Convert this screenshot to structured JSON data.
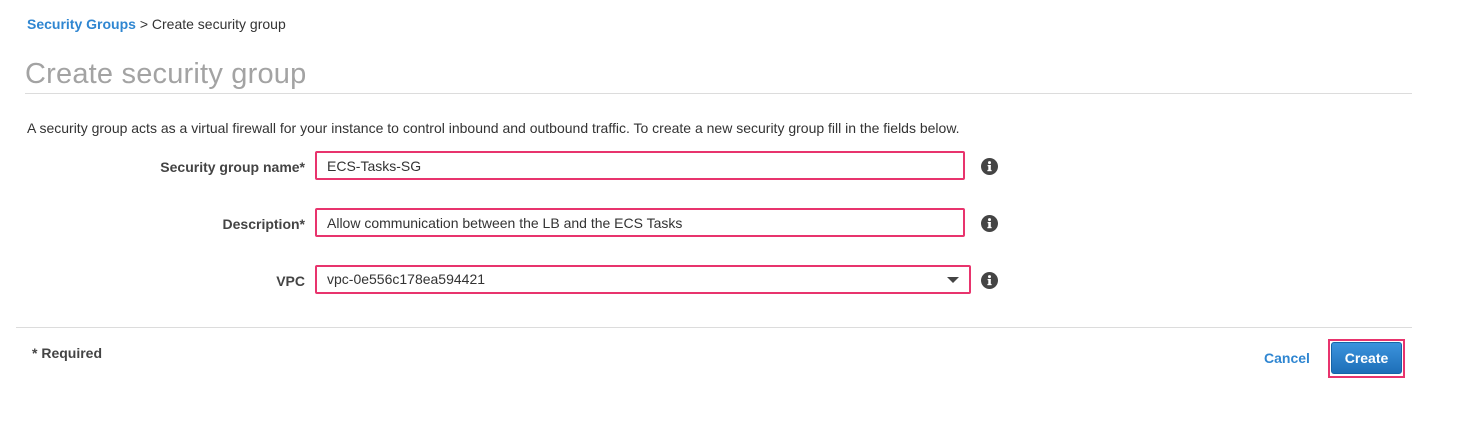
{
  "breadcrumb": {
    "parent": "Security Groups",
    "separator": ">",
    "current": "Create security group"
  },
  "page": {
    "title": "Create security group",
    "intro": "A security group acts as a virtual firewall for your instance to control inbound and outbound traffic. To create a new security group fill in the fields below."
  },
  "form": {
    "name_label": "Security group name*",
    "name_value": "ECS-Tasks-SG",
    "description_label": "Description*",
    "description_value": "Allow communication between the LB and the ECS Tasks",
    "vpc_label": "VPC",
    "vpc_value": "vpc-0e556c178ea594421"
  },
  "footer": {
    "required_note": "* Required",
    "cancel_label": "Cancel",
    "create_label": "Create"
  },
  "icons": {
    "info": "info-icon",
    "dropdown": "chevron-down-icon"
  },
  "colors": {
    "link": "#2f86d1",
    "highlight": "#e8346d",
    "primary_button": "#1e6fb8",
    "title": "#a3a3a3"
  }
}
